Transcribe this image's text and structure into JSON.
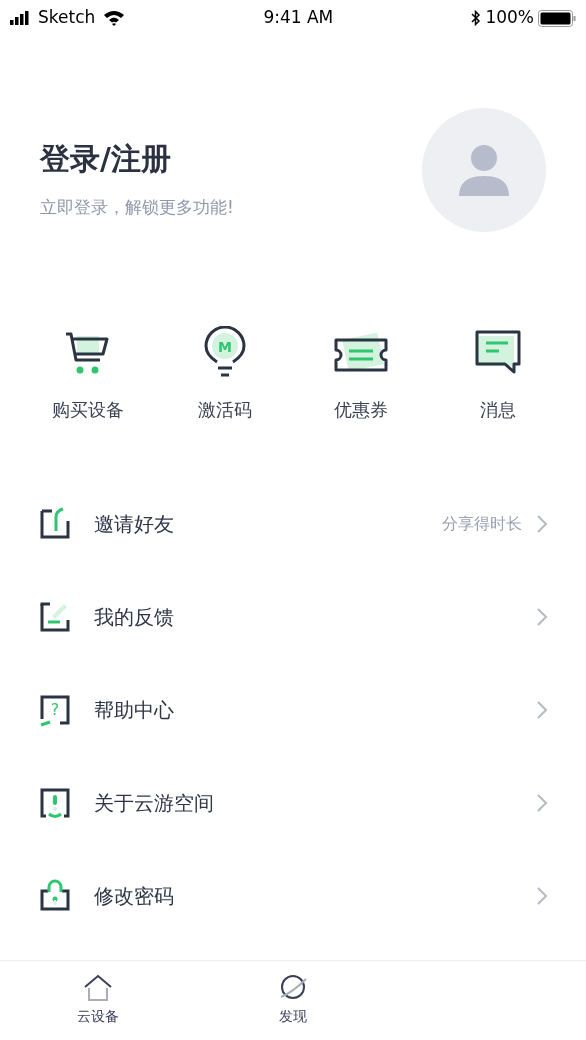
{
  "status_bar": {
    "carrier": "Sketch",
    "time": "9:41 AM",
    "battery": "100%"
  },
  "profile": {
    "title": "登录/注册",
    "subtitle": "立即登录，解锁更多功能!"
  },
  "shortcuts": [
    {
      "kind": "cart",
      "label": "购买设备"
    },
    {
      "kind": "bulb",
      "label": "激活码",
      "glyph": "M"
    },
    {
      "kind": "ticket",
      "label": "优惠券"
    },
    {
      "kind": "message",
      "label": "消息"
    }
  ],
  "menu": [
    {
      "kind": "share",
      "label": "邀请好友",
      "hint": "分享得时长"
    },
    {
      "kind": "feedback",
      "label": "我的反馈"
    },
    {
      "kind": "help",
      "label": "帮助中心",
      "glyph": "?"
    },
    {
      "kind": "about",
      "label": "关于云游空间"
    },
    {
      "kind": "lock",
      "label": "修改密码"
    }
  ],
  "tab_bar": [
    {
      "kind": "home",
      "label": "云设备",
      "selected": false
    },
    {
      "kind": "planet",
      "label": "发现",
      "selected": false
    }
  ]
}
